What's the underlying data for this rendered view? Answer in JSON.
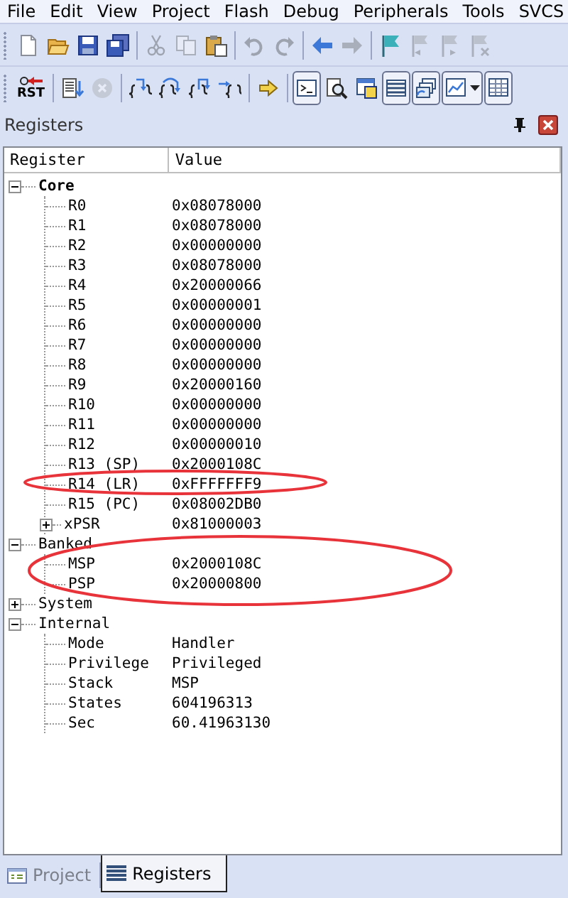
{
  "menu": [
    {
      "label": "File"
    },
    {
      "label": "Edit"
    },
    {
      "label": "View"
    },
    {
      "label": "Project"
    },
    {
      "label": "Flash"
    },
    {
      "label": "Debug"
    },
    {
      "label": "Peripherals"
    },
    {
      "label": "Tools"
    },
    {
      "label": "SVCS"
    }
  ],
  "toolbars": [
    {
      "items": [
        {
          "kind": "new",
          "disabled": false,
          "pressed": false
        },
        {
          "kind": "open",
          "disabled": false,
          "pressed": false
        },
        {
          "kind": "save",
          "disabled": false,
          "pressed": false
        },
        {
          "kind": "saveall",
          "disabled": false,
          "pressed": false
        },
        {
          "kind": "separator"
        },
        {
          "kind": "cut",
          "disabled": true,
          "pressed": false
        },
        {
          "kind": "copy",
          "disabled": true,
          "pressed": false
        },
        {
          "kind": "paste",
          "disabled": false,
          "pressed": false
        },
        {
          "kind": "separator"
        },
        {
          "kind": "undo",
          "disabled": true,
          "pressed": false
        },
        {
          "kind": "redo",
          "disabled": true,
          "pressed": false
        },
        {
          "kind": "separator"
        },
        {
          "kind": "back",
          "disabled": false,
          "pressed": false
        },
        {
          "kind": "forward",
          "disabled": true,
          "pressed": false
        },
        {
          "kind": "separator"
        },
        {
          "kind": "flag",
          "disabled": false,
          "pressed": false
        },
        {
          "kind": "flagprev",
          "disabled": true,
          "pressed": false
        },
        {
          "kind": "flagnext",
          "disabled": true,
          "pressed": false
        },
        {
          "kind": "flagclear",
          "disabled": true,
          "pressed": false
        }
      ]
    },
    {
      "items": [
        {
          "kind": "reset",
          "label": "RST",
          "disabled": false,
          "pressed": false
        },
        {
          "kind": "separator"
        },
        {
          "kind": "run",
          "disabled": false,
          "pressed": false
        },
        {
          "kind": "stop",
          "disabled": true,
          "pressed": false
        },
        {
          "kind": "separator"
        },
        {
          "kind": "stepin",
          "disabled": false,
          "pressed": false
        },
        {
          "kind": "stepover",
          "disabled": false,
          "pressed": false
        },
        {
          "kind": "stepout",
          "disabled": false,
          "pressed": false
        },
        {
          "kind": "runcursor",
          "disabled": false,
          "pressed": false
        },
        {
          "kind": "separator"
        },
        {
          "kind": "showpc",
          "disabled": false,
          "pressed": false
        },
        {
          "kind": "separator"
        },
        {
          "kind": "command",
          "disabled": false,
          "pressed": true
        },
        {
          "kind": "disasm",
          "disabled": false,
          "pressed": false
        },
        {
          "kind": "symbols",
          "disabled": false,
          "pressed": false
        },
        {
          "kind": "registers",
          "disabled": false,
          "pressed": true
        },
        {
          "kind": "callstack",
          "disabled": false,
          "pressed": true
        },
        {
          "kind": "watch",
          "disabled": false,
          "pressed": true
        },
        {
          "kind": "memory",
          "disabled": false,
          "pressed": true
        }
      ]
    }
  ],
  "panel": {
    "title": "Registers",
    "columns": [
      "Register",
      "Value"
    ],
    "tree": [
      {
        "name": "Core",
        "bold": true,
        "expanded": true,
        "circled": false,
        "children": [
          {
            "name": "R0",
            "value": "0x08078000",
            "circled": false
          },
          {
            "name": "R1",
            "value": "0x08078000",
            "circled": false
          },
          {
            "name": "R2",
            "value": "0x00000000",
            "circled": false
          },
          {
            "name": "R3",
            "value": "0x08078000",
            "circled": false
          },
          {
            "name": "R4",
            "value": "0x20000066",
            "circled": false
          },
          {
            "name": "R5",
            "value": "0x00000001",
            "circled": false
          },
          {
            "name": "R6",
            "value": "0x00000000",
            "circled": false
          },
          {
            "name": "R7",
            "value": "0x00000000",
            "circled": false
          },
          {
            "name": "R8",
            "value": "0x00000000",
            "circled": false
          },
          {
            "name": "R9",
            "value": "0x20000160",
            "circled": false
          },
          {
            "name": "R10",
            "value": "0x00000000",
            "circled": false
          },
          {
            "name": "R11",
            "value": "0x00000000",
            "circled": false
          },
          {
            "name": "R12",
            "value": "0x00000010",
            "circled": false
          },
          {
            "name": "R13 (SP)",
            "value": "0x2000108C",
            "circled": false
          },
          {
            "name": "R14 (LR)",
            "value": "0xFFFFFFF9",
            "circled": true
          },
          {
            "name": "R15 (PC)",
            "value": "0x08002DB0",
            "circled": false
          },
          {
            "name": "xPSR",
            "value": "0x81000003",
            "expanded": false,
            "circled": false
          }
        ]
      },
      {
        "name": "Banked",
        "bold": false,
        "expanded": true,
        "circled": true,
        "children": [
          {
            "name": "MSP",
            "value": "0x2000108C",
            "circled": false
          },
          {
            "name": "PSP",
            "value": "0x20000800",
            "circled": false
          }
        ]
      },
      {
        "name": "System",
        "bold": false,
        "expanded": false,
        "circled": false
      },
      {
        "name": "Internal",
        "bold": false,
        "expanded": true,
        "circled": false,
        "children": [
          {
            "name": "Mode",
            "value": "Handler",
            "circled": false
          },
          {
            "name": "Privilege",
            "value": "Privileged",
            "circled": false
          },
          {
            "name": "Stack",
            "value": "MSP",
            "circled": false
          },
          {
            "name": "States",
            "value": "604196313",
            "circled": false
          },
          {
            "name": "Sec",
            "value": "60.41963130",
            "circled": false
          }
        ]
      }
    ]
  },
  "tabs": [
    {
      "kind": "project",
      "label": "Project",
      "selected": false
    },
    {
      "kind": "registers",
      "label": "Registers",
      "selected": true
    }
  ]
}
